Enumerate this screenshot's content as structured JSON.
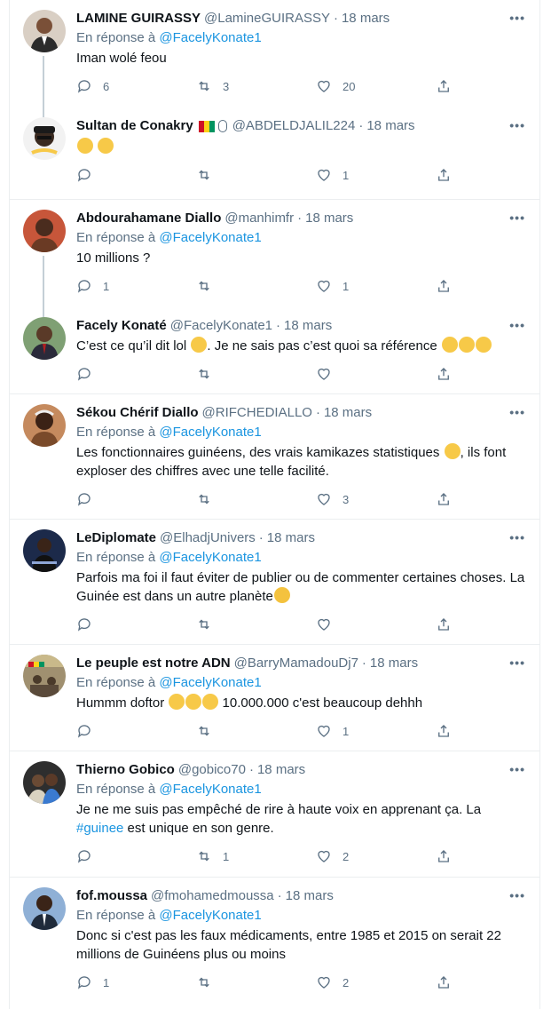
{
  "tweets": [
    {
      "name": "LAMINE GUIRASSY",
      "handle": "@LamineGUIRASSY",
      "date": "18 mars",
      "reply_prefix": "En réponse à",
      "reply_to": "@FacelyKonate1",
      "text": "Iman wolé feou",
      "replies": "6",
      "retweets": "3",
      "likes": "20",
      "avatar_bg": "#c9b9a8"
    },
    {
      "name": "Sultan de Conakry",
      "handle": "@ABDELDJALIL224",
      "date": "18 mars",
      "replies": "",
      "retweets": "",
      "likes": "1",
      "avatar_bg": "#e8e8e8"
    },
    {
      "name": "Abdourahamane Diallo",
      "handle": "@manhimfr",
      "date": "18 mars",
      "reply_prefix": "En réponse à",
      "reply_to": "@FacelyKonate1",
      "text": "10 millions ?",
      "replies": "1",
      "retweets": "",
      "likes": "1",
      "avatar_bg": "#b85a3a"
    },
    {
      "name": "Facely Konaté",
      "handle": "@FacelyKonate1",
      "date": "18 mars",
      "text_a": "C’est ce qu’il dit lol",
      "text_b": ". Je ne sais pas c’est quoi sa référence",
      "replies": "",
      "retweets": "",
      "likes": "",
      "avatar_bg": "#6b8f5e"
    },
    {
      "name": "Sékou Chérif Diallo",
      "handle": "@RIFCHEDIALLO",
      "date": "18 mars",
      "reply_prefix": "En réponse à",
      "reply_to": "@FacelyKonate1",
      "text_a": "Les fonctionnaires guinéens, des vrais kamikazes statistiques",
      "text_b": ", ils font exploser des chiffres avec une telle facilité.",
      "replies": "",
      "retweets": "",
      "likes": "3",
      "avatar_bg": "#a86d4c"
    },
    {
      "name": "LeDiplomate",
      "handle": "@ElhadjUnivers",
      "date": "18 mars",
      "reply_prefix": "En réponse à",
      "reply_to": "@FacelyKonate1",
      "text_a": "Parfois ma foi il faut éviter de publier ou de commenter certaines choses. La Guinée est dans un autre planète",
      "replies": "",
      "retweets": "",
      "likes": "",
      "avatar_bg": "#1c2a4a"
    },
    {
      "name": "Le peuple est notre ADN",
      "handle": "@BarryMamadouDj7",
      "date": "18 mars",
      "reply_prefix": "En réponse à",
      "reply_to": "@FacelyKonate1",
      "text_a": "Hummm doftor",
      "text_b": " 10.000.000 c'est beaucoup dehhh",
      "replies": "",
      "retweets": "",
      "likes": "1",
      "avatar_bg": "#8a7a60"
    },
    {
      "name": "Thierno Gobico",
      "handle": "@gobico70",
      "date": "18 mars",
      "reply_prefix": "En réponse à",
      "reply_to": "@FacelyKonate1",
      "text_a": "Je ne me suis pas empêché de rire à haute voix en apprenant ça. La ",
      "hashtag": "#guinee",
      "text_b": " est unique en son genre.",
      "replies": "",
      "retweets": "1",
      "likes": "2",
      "avatar_bg": "#3c3c3c"
    },
    {
      "name": "fof.moussa",
      "handle": "@fmohamedmoussa",
      "date": "18 mars",
      "reply_prefix": "En réponse à",
      "reply_to": "@FacelyKonate1",
      "text": "Donc si c'est pas les faux médicaments, entre 1985 et 2015 on serait 22 millions de Guinéens  plus ou moins",
      "replies": "1",
      "retweets": "",
      "likes": "2",
      "avatar_bg": "#6e8fb3"
    }
  ],
  "colors": {
    "accent": "#1b95e0",
    "secondary_text": "#5b7083",
    "divider": "#ebeef0"
  },
  "icons": [
    "reply-icon",
    "retweet-icon",
    "like-icon",
    "share-icon",
    "more-icon"
  ]
}
